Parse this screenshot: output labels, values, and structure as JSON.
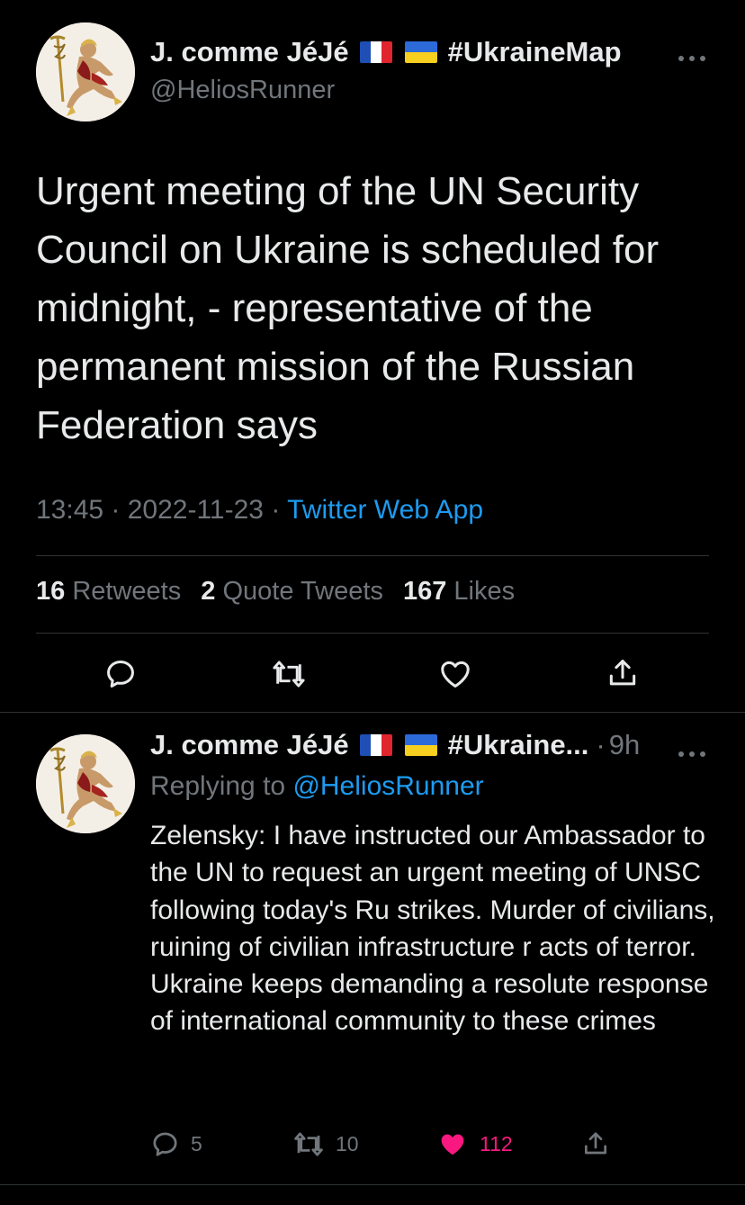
{
  "main_tweet": {
    "author": {
      "name": "J. comme JéJé",
      "hashtag": "#UkraineMap",
      "handle": "@HeliosRunner"
    },
    "text": "Urgent meeting of the UN Security Council on Ukraine is scheduled for midnight, - representative of the permanent mission of the Russian Federation says",
    "time": "13:45",
    "date": "2022-11-23",
    "source": "Twitter Web App",
    "stats": {
      "retweets_count": "16",
      "retweets_label": "Retweets",
      "quotes_count": "2",
      "quotes_label": "Quote Tweets",
      "likes_count": "167",
      "likes_label": "Likes"
    }
  },
  "reply": {
    "author": {
      "name": "J. comme JéJé",
      "hashtag_truncated": "#Ukraine...",
      "time_ago": "9h"
    },
    "replying_prefix": "Replying to",
    "replying_to": "@HeliosRunner",
    "text": "Zelensky: I have instructed our Ambassador to the UN to request an urgent meeting of UNSC following today's Ru strikes. Murder of civilians, ruining of civilian infrastructure r acts of terror. Ukraine keeps demanding a resolute response of international community to these crimes",
    "counts": {
      "replies": "5",
      "retweets": "10",
      "likes": "112"
    }
  },
  "colors": {
    "background": "#000000",
    "text": "#e7e9ea",
    "muted": "#71767b",
    "link": "#1d9bf0",
    "like_active": "#f91880",
    "divider": "#2f3336"
  },
  "icons": {
    "avatar": "hermes-avatar",
    "flag_1": "france-flag-icon",
    "flag_2": "ukraine-flag-icon",
    "more": "more-icon",
    "reply": "reply-icon",
    "retweet": "retweet-icon",
    "like": "heart-icon",
    "share": "share-icon"
  }
}
